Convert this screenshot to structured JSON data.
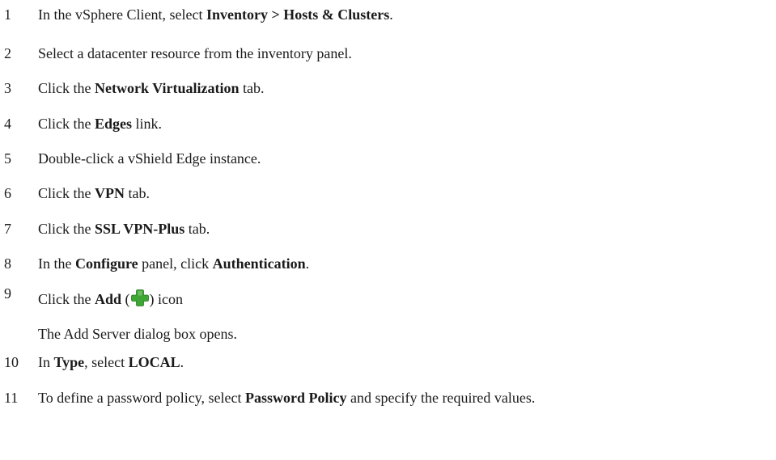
{
  "steps": [
    {
      "num": "1",
      "parts": [
        {
          "t": "In the vSphere Client, select ",
          "b": false
        },
        {
          "t": "Inventory > Hosts & Clusters",
          "b": true
        },
        {
          "t": ".",
          "b": false
        }
      ]
    },
    {
      "num": "2",
      "parts": [
        {
          "t": "Select a datacenter resource from the inventory panel.",
          "b": false
        }
      ]
    },
    {
      "num": "3",
      "parts": [
        {
          "t": "Click the ",
          "b": false
        },
        {
          "t": "Network Virtualization",
          "b": true
        },
        {
          "t": " tab.",
          "b": false
        }
      ]
    },
    {
      "num": "4",
      "parts": [
        {
          "t": "Click the ",
          "b": false
        },
        {
          "t": "Edges",
          "b": true
        },
        {
          "t": " link.",
          "b": false
        }
      ]
    },
    {
      "num": "5",
      "parts": [
        {
          "t": "Double-click a vShield Edge instance.",
          "b": false
        }
      ]
    },
    {
      "num": "6",
      "parts": [
        {
          "t": "Click the ",
          "b": false
        },
        {
          "t": "VPN",
          "b": true
        },
        {
          "t": " tab.",
          "b": false
        }
      ]
    },
    {
      "num": "7",
      "parts": [
        {
          "t": "Click the ",
          "b": false
        },
        {
          "t": "SSL VPN-Plus",
          "b": true
        },
        {
          "t": " tab.",
          "b": false
        }
      ]
    },
    {
      "num": "8",
      "parts": [
        {
          "t": "In the ",
          "b": false
        },
        {
          "t": "Configure",
          "b": true
        },
        {
          "t": " panel, click ",
          "b": false
        },
        {
          "t": "Authentication",
          "b": true
        },
        {
          "t": ".",
          "b": false
        }
      ]
    },
    {
      "num": "9",
      "parts": [
        {
          "t": "Click the ",
          "b": false
        },
        {
          "t": "Add",
          "b": true
        },
        {
          "t": " (",
          "b": false
        },
        {
          "icon": "add-plus-icon",
          "color": "#3fa535"
        },
        {
          "t": ") icon",
          "b": false
        }
      ],
      "subtext": "The Add Server dialog box opens."
    },
    {
      "num": "10",
      "parts": [
        {
          "t": "In ",
          "b": false
        },
        {
          "t": "Type",
          "b": true
        },
        {
          "t": ", select ",
          "b": false
        },
        {
          "t": "LOCAL",
          "b": true
        },
        {
          "t": ".",
          "b": false
        }
      ]
    },
    {
      "num": "11",
      "parts": [
        {
          "t": "To define a password policy, select ",
          "b": false
        },
        {
          "t": "Password Policy",
          "b": true
        },
        {
          "t": " and specify the required values.",
          "b": false
        }
      ]
    }
  ]
}
